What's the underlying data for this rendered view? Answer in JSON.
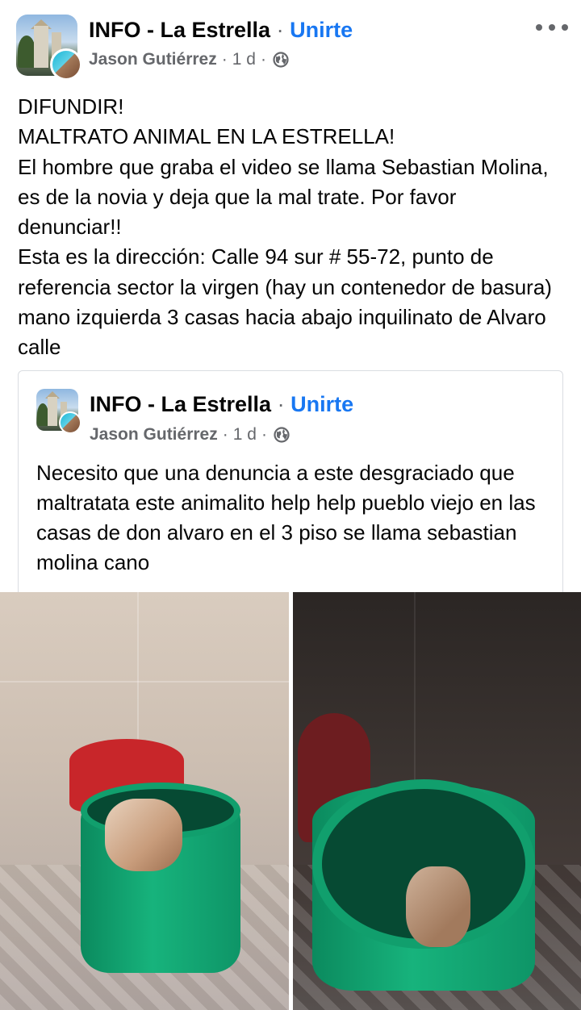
{
  "post": {
    "group_name": "INFO - La Estrella",
    "separator": "·",
    "join_label": "Unirte",
    "author": "Jason Gutiérrez",
    "time": "1 d",
    "privacy_icon": "globe-icon",
    "more_icon": "more-options-icon",
    "text": "DIFUNDIR!\nMALTRATO ANIMAL EN LA ESTRELLA!\nEl hombre que graba el video se llama Sebastian Molina, es de la novia y deja que la mal trate. Por favor denunciar!!\nEsta es la dirección: Calle 94 sur # 55-72, punto de referencia sector la virgen (hay un contenedor de basura) mano izquierda 3 casas hacia abajo inquilinato de Alvaro calle"
  },
  "shared_post": {
    "group_name": "INFO - La Estrella",
    "separator": "·",
    "join_label": "Unirte",
    "author": "Jason Gutiérrez",
    "time": "1 d",
    "privacy_icon": "globe-icon",
    "text": "Necesito que una denuncia a este desgraciado que maltratata este animalito help help pueblo viejo en las casas de don alvaro en el 3 piso se llama sebastian molina cano"
  },
  "colors": {
    "link_blue": "#1877f2",
    "secondary_text": "#65676b",
    "primary_text": "#050505",
    "card_border": "#dadde1"
  }
}
